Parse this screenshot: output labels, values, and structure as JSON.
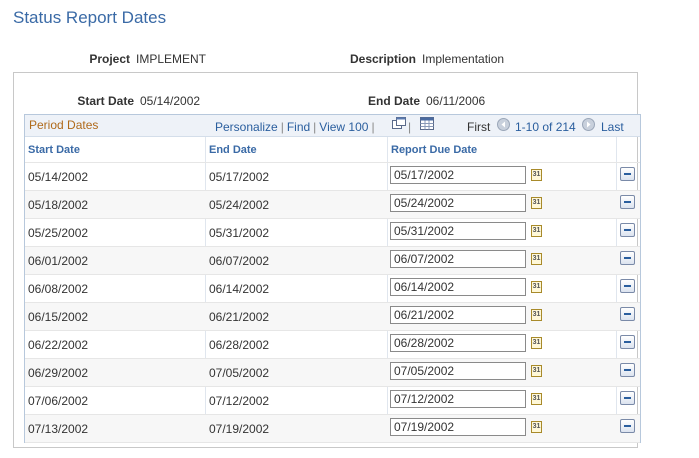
{
  "page": {
    "title": "Status Report Dates"
  },
  "header": {
    "project_label": "Project",
    "project_value": "IMPLEMENT",
    "description_label": "Description",
    "description_value": "Implementation",
    "start_date_label": "Start Date",
    "start_date_value": "05/14/2002",
    "end_date_label": "End Date",
    "end_date_value": "06/11/2006"
  },
  "grid": {
    "title": "Period Dates",
    "personalize": "Personalize",
    "find": "Find",
    "view": "View 100",
    "first": "First",
    "range": "1-10 of 214",
    "last": "Last",
    "columns": [
      "Start Date",
      "End Date",
      "Report Due Date"
    ],
    "rows": [
      {
        "start": "05/14/2002",
        "end": "05/17/2002",
        "due": "05/17/2002"
      },
      {
        "start": "05/18/2002",
        "end": "05/24/2002",
        "due": "05/24/2002"
      },
      {
        "start": "05/25/2002",
        "end": "05/31/2002",
        "due": "05/31/2002"
      },
      {
        "start": "06/01/2002",
        "end": "06/07/2002",
        "due": "06/07/2002"
      },
      {
        "start": "06/08/2002",
        "end": "06/14/2002",
        "due": "06/14/2002"
      },
      {
        "start": "06/15/2002",
        "end": "06/21/2002",
        "due": "06/21/2002"
      },
      {
        "start": "06/22/2002",
        "end": "06/28/2002",
        "due": "06/28/2002"
      },
      {
        "start": "06/29/2002",
        "end": "07/05/2002",
        "due": "07/05/2002"
      },
      {
        "start": "07/06/2002",
        "end": "07/12/2002",
        "due": "07/12/2002"
      },
      {
        "start": "07/13/2002",
        "end": "07/19/2002",
        "due": "07/19/2002"
      }
    ]
  },
  "icons": {
    "calendar": "calendar-icon",
    "delete_row": "delete-row-icon",
    "new_window": "new-window-icon",
    "spreadsheet": "spreadsheet-icon",
    "prev": "previous-arrow-icon",
    "next": "next-arrow-icon"
  }
}
